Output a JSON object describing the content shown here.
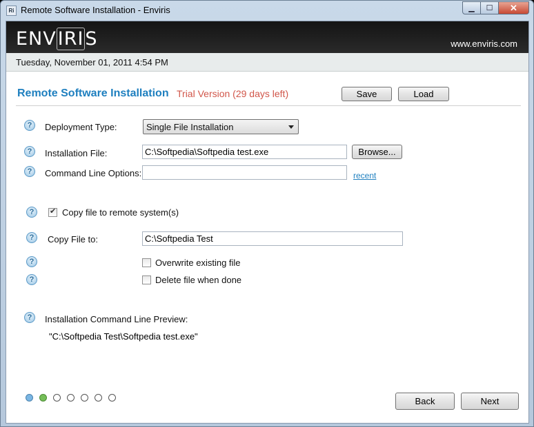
{
  "window": {
    "title": "Remote Software Installation - Enviris",
    "icon_text": "Ri",
    "close_label": "✕",
    "max_label": "☐",
    "min_label": "▁"
  },
  "header": {
    "logo": "ENVIRIS",
    "logo_pre": "ENV",
    "logo_box": "IRI",
    "logo_post": "S",
    "website": "www.enviris.com",
    "date": "Tuesday, November 01, 2011 4:54 PM"
  },
  "page": {
    "title": "Remote Software Installation",
    "trial": "Trial Version (29 days left)",
    "save_label": "Save",
    "load_label": "Load"
  },
  "form": {
    "deployment_type_label": "Deployment Type:",
    "deployment_type_value": "Single File Installation",
    "installation_file_label": "Installation File:",
    "installation_file_value": "C:\\Softpedia\\Softpedia test.exe",
    "browse_label": "Browse...",
    "command_line_label": "Command Line Options:",
    "command_line_value": "",
    "recent_label": "recent",
    "copy_file_checkbox_label": "Copy file to remote system(s)",
    "copy_file_checked": true,
    "copy_file_to_label": "Copy File to:",
    "copy_file_to_value": "C:\\Softpedia Test",
    "overwrite_label": "Overwrite existing file",
    "overwrite_checked": false,
    "delete_label": "Delete file when done",
    "delete_checked": false,
    "preview_label": "Installation Command Line Preview:",
    "preview_value": "\"C:\\Softpedia Test\\Softpedia test.exe\""
  },
  "wizard": {
    "steps": [
      "blue",
      "green",
      "empty",
      "empty",
      "empty",
      "empty",
      "empty"
    ],
    "back_label": "Back",
    "next_label": "Next"
  },
  "help_icon_glyph": "?"
}
